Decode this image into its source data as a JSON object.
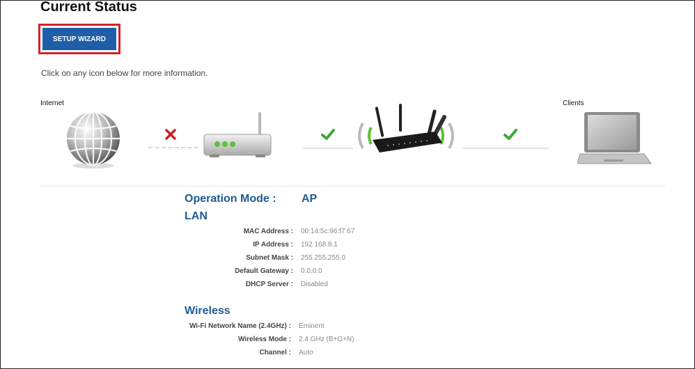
{
  "header": {
    "title": "Current Status"
  },
  "wizard": {
    "label": "SETUP WIZARD"
  },
  "hint": "Click on any icon below for more information.",
  "diagram": {
    "internet_label": "Internet",
    "clients_label": "Clients",
    "links": [
      {
        "name": "internet-to-modem",
        "status": "disconnected",
        "icon": "x-mark-icon",
        "color": "#cc2020"
      },
      {
        "name": "modem-to-router",
        "status": "connected",
        "icon": "check-icon",
        "color": "#3ca832"
      },
      {
        "name": "router-to-clients",
        "status": "connected",
        "icon": "check-icon",
        "color": "#3ca832"
      }
    ]
  },
  "operation": {
    "label": "Operation Mode :",
    "value": "AP"
  },
  "lan": {
    "title": "LAN",
    "rows": [
      {
        "label": "MAC Address :",
        "value": "00:14:5c:96:f7:67"
      },
      {
        "label": "IP Address :",
        "value": "192.168.8.1"
      },
      {
        "label": "Subnet Mask :",
        "value": "255.255.255.0"
      },
      {
        "label": "Default Gateway :",
        "value": "0.0.0.0"
      },
      {
        "label": "DHCP Server :",
        "value": "Disabled"
      }
    ]
  },
  "wireless": {
    "title": "Wireless",
    "rows": [
      {
        "label": "Wi-Fi Network Name (2.4GHz) :",
        "value": "Eminent"
      },
      {
        "label": "Wireless Mode :",
        "value": "2.4 GHz (B+G+N)"
      },
      {
        "label": "Channel :",
        "value": "Auto"
      }
    ]
  },
  "colors": {
    "accent": "#1f5fa7",
    "highlight": "#d61f2b",
    "heading": "#1f5a92"
  }
}
